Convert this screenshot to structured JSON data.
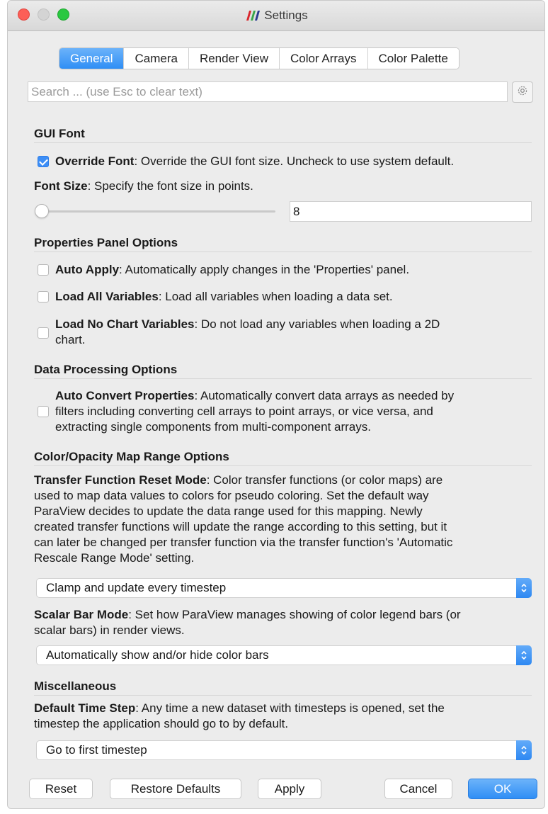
{
  "window": {
    "title": "Settings"
  },
  "tabs": [
    {
      "label": "General",
      "active": true
    },
    {
      "label": "Camera",
      "active": false
    },
    {
      "label": "Render View",
      "active": false
    },
    {
      "label": "Color Arrays",
      "active": false
    },
    {
      "label": "Color Palette",
      "active": false
    }
  ],
  "search": {
    "placeholder": "Search ... (use Esc to clear text)",
    "value": ""
  },
  "gui_font": {
    "title": "GUI Font",
    "override_font": {
      "checked": true,
      "label": "Override Font",
      "desc": ": Override the GUI font size. Uncheck to use system default."
    },
    "font_size": {
      "label": "Font Size",
      "desc": ": Specify the font size in points.",
      "value": "8",
      "slider_fraction": 0.0
    }
  },
  "properties_panel": {
    "title": "Properties Panel Options",
    "auto_apply": {
      "checked": false,
      "label": "Auto Apply",
      "desc": ": Automatically apply changes in the 'Properties' panel."
    },
    "load_all": {
      "checked": false,
      "label": "Load All Variables",
      "desc": ": Load all variables when loading a data set."
    },
    "load_no_chart": {
      "checked": false,
      "label": "Load No Chart Variables",
      "desc_line1": ": Do not load any variables when loading a 2D",
      "desc_line2": "chart."
    }
  },
  "data_processing": {
    "title": "Data Processing Options",
    "auto_convert": {
      "checked": false,
      "label": "Auto Convert Properties",
      "line1": ": Automatically convert data arrays as needed by",
      "line2": "filters including converting cell arrays to point arrays, or vice versa, and",
      "line3": "extracting single components from multi-component arrays."
    }
  },
  "color_opacity": {
    "title": "Color/Opacity Map Range Options",
    "transfer_reset": {
      "label": "Transfer Function Reset Mode",
      "line1": ": Color transfer functions (or color maps) are",
      "line2": "used to map data values to colors for pseudo coloring. Set the default way",
      "line3": "ParaView decides to update the data range used for this mapping. Newly",
      "line4": "created transfer functions will update the range according to this setting, but it",
      "line5": "can later be changed per transfer function via the transfer function's 'Automatic",
      "line6": "Rescale Range Mode' setting.",
      "selected": "Clamp and update every timestep"
    },
    "scalar_bar": {
      "label": "Scalar Bar Mode",
      "line1": ": Set how ParaView manages showing of color legend bars (or",
      "line2": "scalar bars) in render views.",
      "selected": "Automatically show and/or hide color bars"
    }
  },
  "misc": {
    "title": "Miscellaneous",
    "default_time_step": {
      "label": "Default Time Step",
      "line1": ": Any time a new dataset with timesteps is opened, set the",
      "line2": "timestep the application should go to by default.",
      "selected": "Go to first timestep"
    }
  },
  "buttons": {
    "reset": "Reset",
    "restore_defaults": "Restore Defaults",
    "apply": "Apply",
    "cancel": "Cancel",
    "ok": "OK"
  },
  "colors": {
    "accent": "#2f8ef5",
    "close": "#fc5f57",
    "maximize": "#2ac840",
    "logo_red": "#d9262c",
    "logo_blue": "#2b3a8f",
    "logo_green": "#3aa54a"
  },
  "icons": [
    "paraview-logo-icon",
    "gear-icon",
    "checkmark-icon",
    "updown-stepper-icon"
  ]
}
